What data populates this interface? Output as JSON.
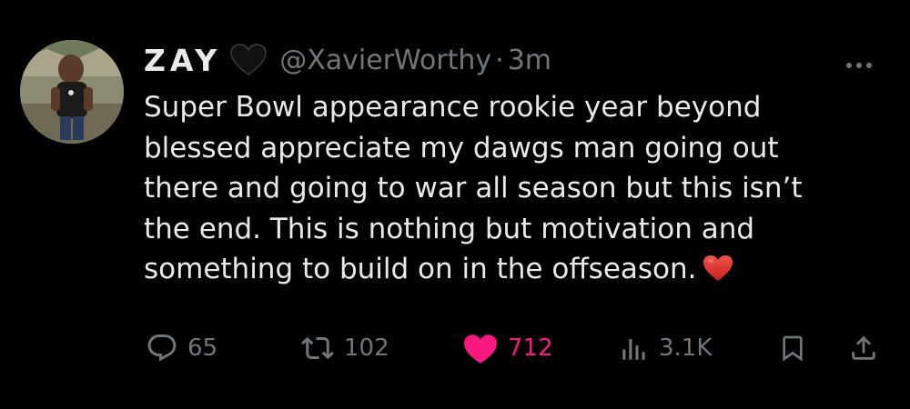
{
  "tweet": {
    "display_name": "ZAY",
    "badge_icon": "black-heart-icon",
    "handle": "@XavierWorthy",
    "separator": "·",
    "time": "3m",
    "text_lines": [
      "Super Bowl appearance rookie year beyond",
      "blessed appreciate my dawgs man going out",
      "there and going to war all season but this isn’t",
      "the end. This is nothing but motivation and",
      "something to build on in the offseason."
    ],
    "trailing_emoji": "red-heart-icon"
  },
  "actions": {
    "replies": "65",
    "reposts": "102",
    "likes": "712",
    "views": "3.1K"
  },
  "colors": {
    "background": "#000000",
    "text": "#e7e9ea",
    "muted": "#71767b",
    "like": "#f91880",
    "heart_emoji": "#e8322b"
  }
}
